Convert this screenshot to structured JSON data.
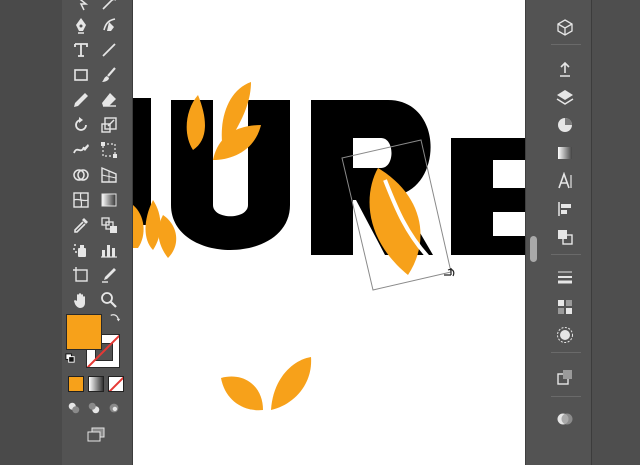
{
  "colors": {
    "fill": "#f7a11a",
    "stroke": "#ffffff",
    "canvas": "#ffffff",
    "letters": "#000000",
    "leaf": "#f7a11a",
    "selection": "#8a8a8a",
    "none_slash": "#e53935"
  },
  "artwork": {
    "letters": [
      "U",
      "R",
      "E"
    ]
  },
  "tools": [
    {
      "name": "pen-icon"
    },
    {
      "name": "curvature-icon"
    },
    {
      "name": "type-icon"
    },
    {
      "name": "line-icon"
    },
    {
      "name": "rectangle-icon"
    },
    {
      "name": "paintbrush-icon"
    },
    {
      "name": "pencil-icon"
    },
    {
      "name": "eraser-icon"
    },
    {
      "name": "rotate-icon"
    },
    {
      "name": "scale-icon"
    },
    {
      "name": "warp-icon"
    },
    {
      "name": "free-transform-icon"
    },
    {
      "name": "shape-builder-icon"
    },
    {
      "name": "perspective-icon"
    },
    {
      "name": "mesh-icon"
    },
    {
      "name": "gradient-icon"
    },
    {
      "name": "eyedropper-icon"
    },
    {
      "name": "blend-icon"
    },
    {
      "name": "symbol-sprayer-icon"
    },
    {
      "name": "graph-icon"
    },
    {
      "name": "artboard-icon"
    },
    {
      "name": "slice-icon"
    },
    {
      "name": "hand-icon"
    },
    {
      "name": "zoom-icon"
    }
  ],
  "panels": [
    {
      "name": "3d-cube-icon"
    },
    {
      "name": "asset-export-icon"
    },
    {
      "name": "layers-icon"
    },
    {
      "name": "color-wheel-icon"
    },
    {
      "name": "gradient-panel-icon"
    },
    {
      "name": "character-icon"
    },
    {
      "name": "align-icon"
    },
    {
      "name": "pathfinder-icon"
    },
    {
      "name": "stroke-panel-icon"
    },
    {
      "name": "swatches-icon"
    },
    {
      "name": "appearance-icon"
    },
    {
      "name": "transform-panel-icon"
    },
    {
      "name": "transparency-icon"
    }
  ]
}
